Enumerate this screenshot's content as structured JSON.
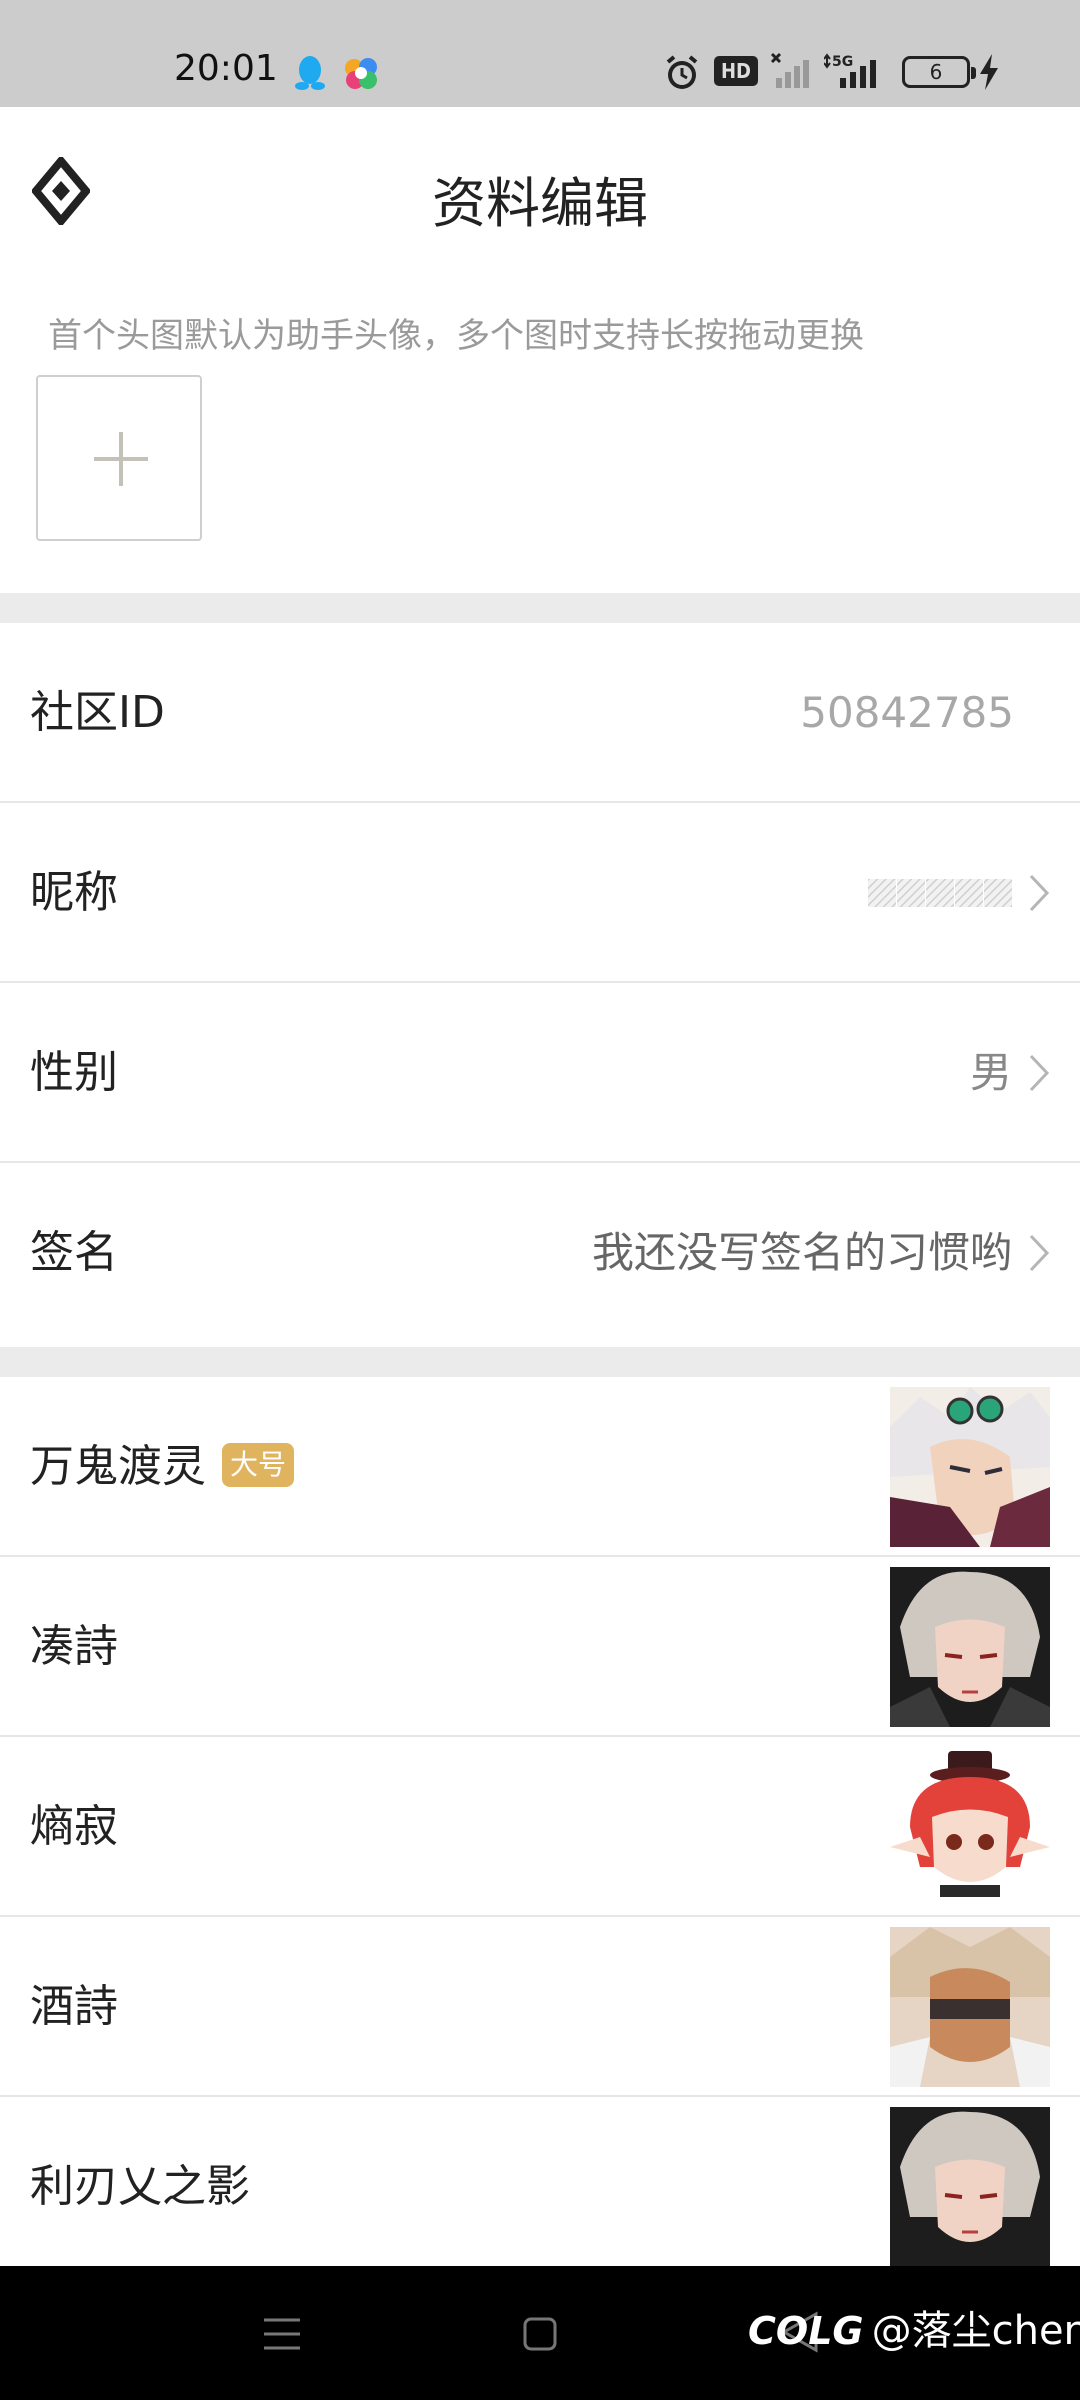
{
  "status_bar": {
    "time": "20:01",
    "hd_label": "HD",
    "battery_level": "6",
    "network_label": "5G"
  },
  "header": {
    "title": "资料编辑"
  },
  "avatar_section": {
    "hint": "首个头图默认为助手头像，多个图时支持长按拖动更换"
  },
  "profile": {
    "community_id_label": "社区ID",
    "community_id_value": "50842785",
    "nickname_label": "昵称",
    "gender_label": "性别",
    "gender_value": "男",
    "signature_label": "签名",
    "signature_value": "我还没写签名的习惯哟"
  },
  "characters": [
    {
      "name": "万鬼渡灵",
      "badge": "大号"
    },
    {
      "name": "凑詩"
    },
    {
      "name": "熵寂"
    },
    {
      "name": "酒詩"
    },
    {
      "name": "利刃乂之影"
    }
  ],
  "watermark": {
    "logo": "COLG",
    "user": "@落尘chen"
  },
  "colors": {
    "status_bar_bg": "#cccccc",
    "divider": "#ebebeb",
    "badge_bg": "#e0b45e"
  }
}
